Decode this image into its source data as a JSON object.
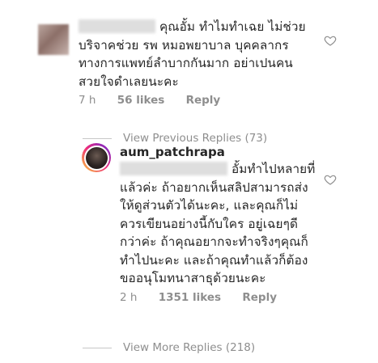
{
  "comment1": {
    "text_line1": "คุณอั้ม ทำไมทำเฉย ไม่ช่วย",
    "text_line2": "บริจาคช่วย รพ หมอพยาบาล บุคคลากร",
    "text_line3": "ทางการแพทย์ลำบากกันมาก  อย่าเปนคน",
    "text_line4": "สวยใจดำเลยนะคะ",
    "time": "7 h",
    "likes": "56 likes",
    "reply": "Reply"
  },
  "view_previous": "View Previous Replies (73)",
  "comment2": {
    "username": "aum_patchrapa",
    "text_line1": "อั้มทำไปหลายที่",
    "text_line2": "แล้วค่ะ ถ้าอยากเห็นสลิปสามารถส่ง",
    "text_line3": "ให้ดูส่วนตัวได้นะคะ, และคุณก็ไม่",
    "text_line4": "ควรเขียนอย่างนี้กับใคร อยู่เฉยๆดี",
    "text_line5": "กว่าค่ะ ถ้าคุณอยากจะทำจริงๆคุณก็",
    "text_line6": "ทำไปนะคะ และถ้าคุณทำแล้วก็ต้อง",
    "text_line7": "ขออนุโมทนาสาธุด้วยนะคะ",
    "time": "2 h",
    "likes": "1351 likes",
    "reply": "Reply"
  },
  "view_more": "View More Replies (218)",
  "icons": {
    "heart": "heart-outline-icon"
  },
  "colors": {
    "text": "#262626",
    "meta": "#8e8e8e",
    "divider": "#c7c7c7"
  }
}
